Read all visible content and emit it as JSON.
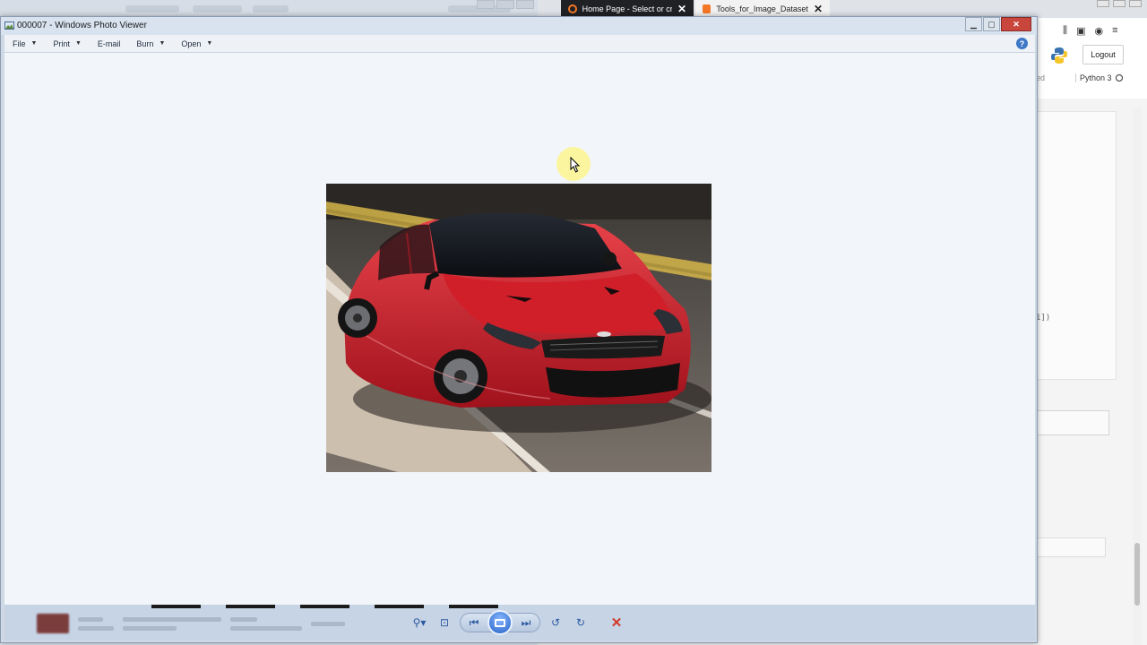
{
  "background": {
    "browser": {
      "tabs": [
        {
          "title": "Home Page - Select or create a",
          "active": true
        },
        {
          "title": "Tools_for_Image_Datasets - Jup",
          "active": false
        }
      ],
      "jupyter": {
        "logout_label": "Logout",
        "kernel_fragment": "ed",
        "kernel_name": "Python 3",
        "code_fragment": "1])"
      }
    }
  },
  "photo_viewer": {
    "title": "000007 - Windows Photo Viewer",
    "menu": [
      {
        "label": "File",
        "has_dropdown": true
      },
      {
        "label": "Print",
        "has_dropdown": true
      },
      {
        "label": "E-mail",
        "has_dropdown": false
      },
      {
        "label": "Burn",
        "has_dropdown": true
      },
      {
        "label": "Open",
        "has_dropdown": true
      }
    ],
    "help_glyph": "?",
    "image": {
      "subject": "red-sedan"
    },
    "controls": {
      "zoom_icon": "zoom-icon",
      "fit_icon": "actual-size-icon",
      "previous_icon": "previous-icon",
      "slideshow_icon": "slideshow-icon",
      "next_icon": "next-icon",
      "rotate_ccw_icon": "rotate-counterclockwise-icon",
      "rotate_cw_icon": "rotate-clockwise-icon",
      "delete_icon": "delete-icon"
    }
  },
  "colors": {
    "viewer_background": "#f2f6fa",
    "titlebar": "#d9e3ef",
    "close_button": "#c9463d",
    "accent_blue": "#2c5aa0",
    "delete_red": "#d23a2a",
    "car_red": "#d4202b"
  }
}
